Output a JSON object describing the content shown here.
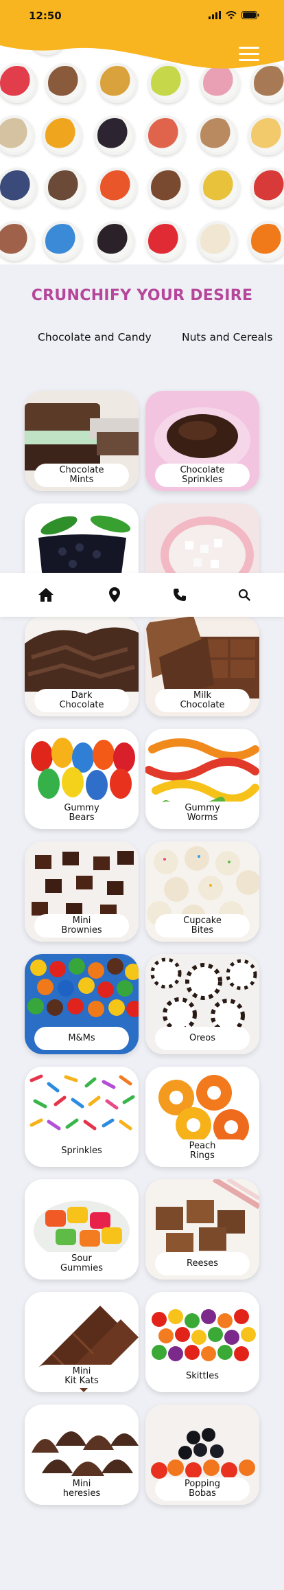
{
  "status_bar": {
    "time": "12:50"
  },
  "header": {
    "menu_icon": "hamburger-menu-icon"
  },
  "title": "CRUNCHIFY YOUR DESIRE",
  "tabs": [
    {
      "label": "Chocolate and Candy"
    },
    {
      "label": "Nuts and Cereals"
    }
  ],
  "colors": {
    "brand_yellow": "#f9b51f",
    "title": "#b5479b",
    "background": "#eff0f5"
  },
  "items": [
    {
      "label": "Chocolate\nMints"
    },
    {
      "label": "Chocolate\nSprinkles"
    },
    {
      "label": ""
    },
    {
      "label": ""
    },
    {
      "label": "Dark\nChocolate"
    },
    {
      "label": "Milk\nChocolate"
    },
    {
      "label": "Gummy\nBears"
    },
    {
      "label": "Gummy\nWorms"
    },
    {
      "label": "Mini\nBrownies"
    },
    {
      "label": "Cupcake\nBites"
    },
    {
      "label": "M&Ms"
    },
    {
      "label": "Oreos"
    },
    {
      "label": "Sprinkles"
    },
    {
      "label": "Peach\nRings"
    },
    {
      "label": "Sour\nGummies"
    },
    {
      "label": "Reeses"
    },
    {
      "label": "Mini\nKit Kats"
    },
    {
      "label": "Skittles"
    },
    {
      "label": "Mini\nheresies"
    },
    {
      "label": "Popping\nBobas"
    }
  ],
  "bottom_nav": [
    {
      "icon": "home-icon"
    },
    {
      "icon": "location-pin-icon"
    },
    {
      "icon": "phone-icon"
    },
    {
      "icon": "search-icon"
    }
  ]
}
